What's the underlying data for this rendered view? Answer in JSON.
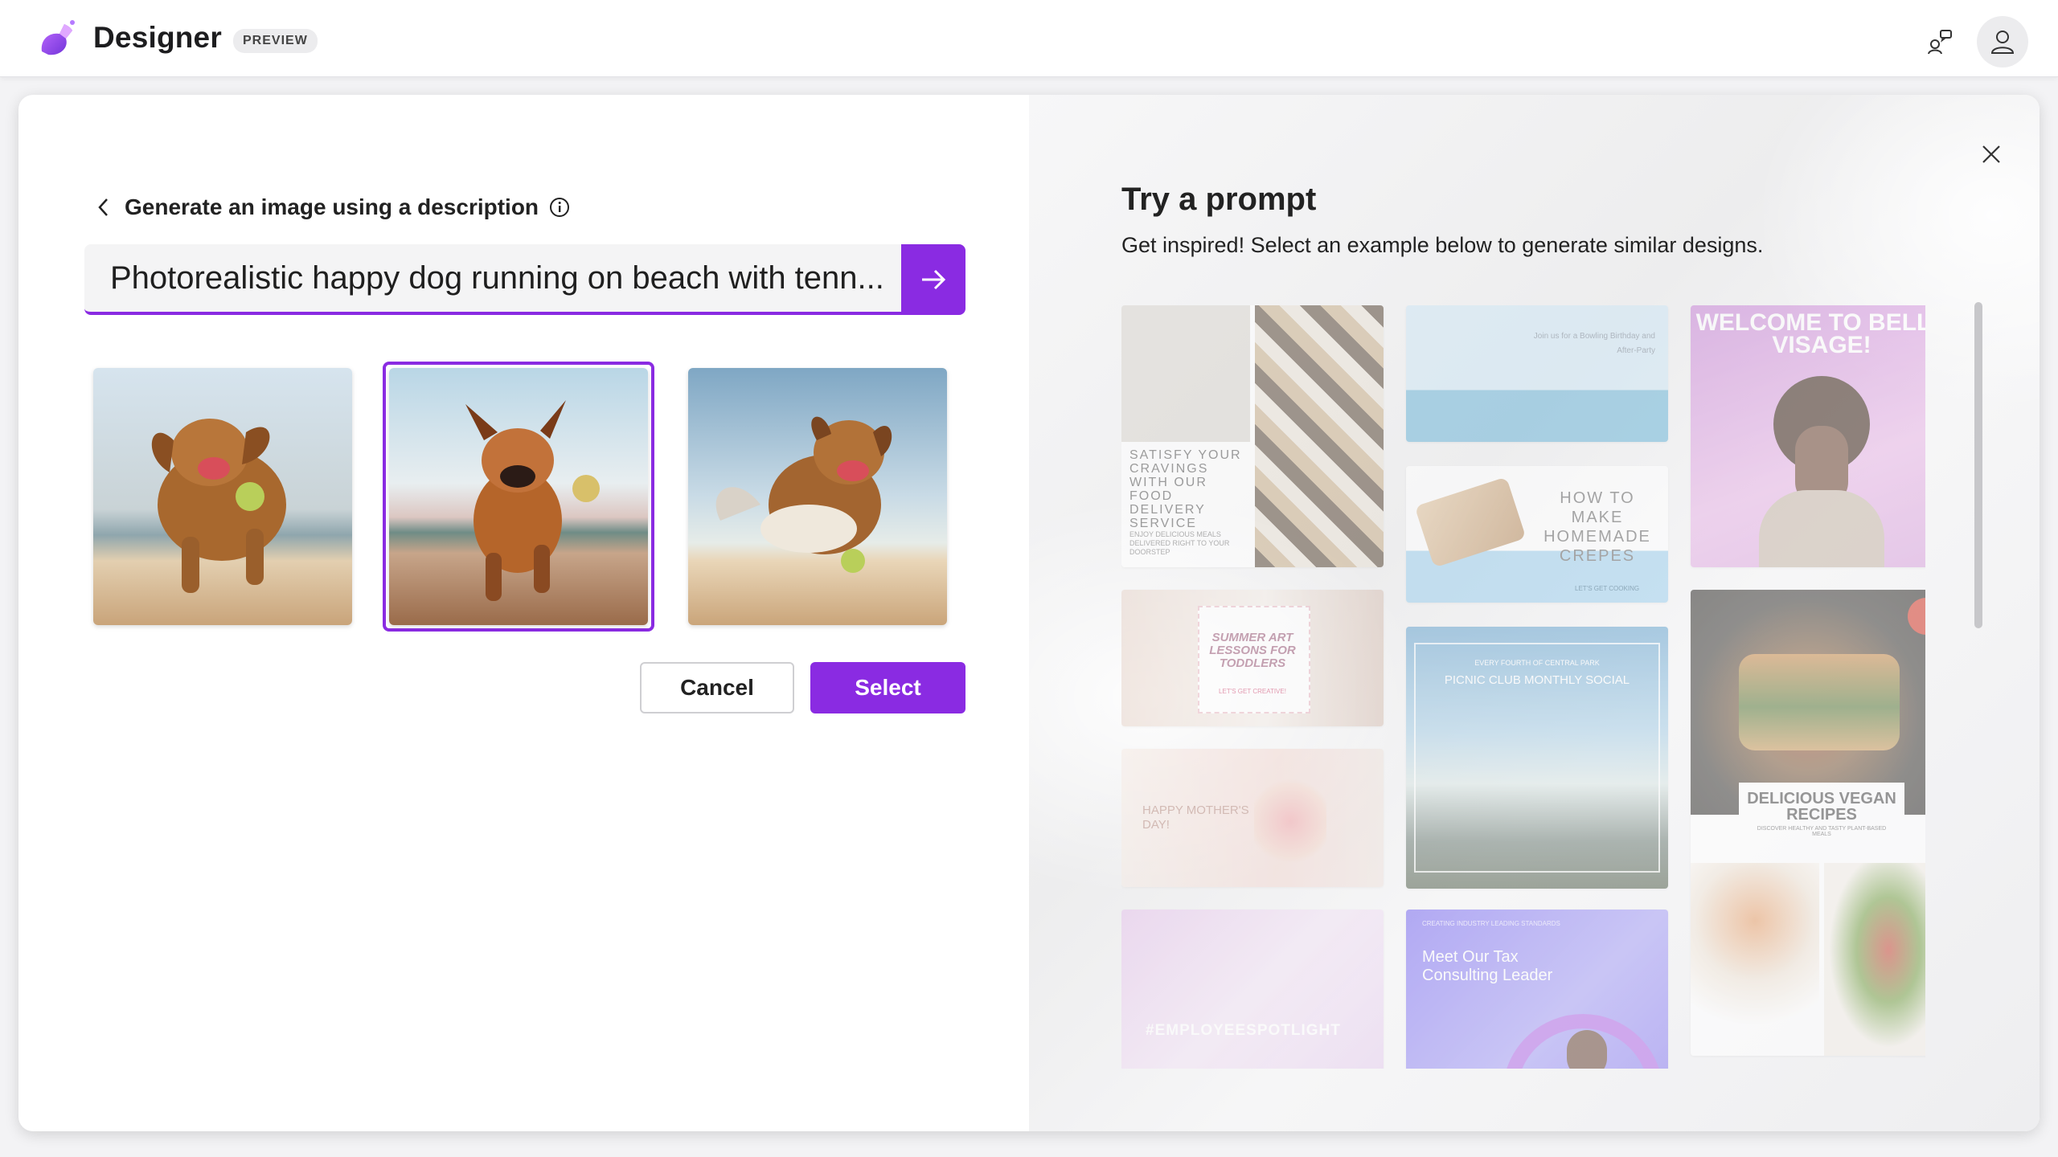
{
  "app": {
    "title": "Designer",
    "badge": "PREVIEW",
    "brand_color": "#8a2be2",
    "feedback_icon": "feedback-icon",
    "account_icon": "person-icon"
  },
  "generate": {
    "heading": "Generate an image using a description",
    "prompt_value": "Photorealistic happy dog running on beach with tenn...",
    "submit_icon": "arrow-right-icon",
    "selected_index": 1,
    "images": [
      {
        "alt": "dog-image-1"
      },
      {
        "alt": "dog-image-2"
      },
      {
        "alt": "dog-image-3"
      }
    ],
    "cancel_label": "Cancel",
    "select_label": "Select"
  },
  "inspire": {
    "title": "Try a prompt",
    "subtitle": "Get inspired! Select an example below to generate similar designs.",
    "cards": {
      "food_delivery": "SATISFY YOUR CRAVINGS WITH OUR FOOD DELIVERY SERVICE",
      "food_delivery_sub": "ENJOY DELICIOUS MEALS DELIVERED RIGHT TO YOUR DOORSTEP",
      "bday_title": "Join us for a Bowling Birthday and After-Party",
      "crepes": "HOW TO MAKE HOMEMADE CREPES",
      "crepes_sub": "LET'S GET COOKING",
      "belle": "WELCOME TO BELLE VISAGE!",
      "summer": "SUMMER ART LESSONS FOR TODDLERS",
      "summer_sub": "LET'S GET CREATIVE!",
      "picnic_small": "EVERY FOURTH OF CENTRAL PARK",
      "picnic": "PICNIC CLUB MONTHLY SOCIAL",
      "vegan": "DELICIOUS VEGAN RECIPES",
      "vegan_sub": "DISCOVER HEALTHY AND TASTY PLANT-BASED MEALS",
      "mother": "HAPPY MOTHER'S DAY!",
      "spotlight": "#EMPLOYEESPOTLIGHT",
      "tax_small": "CREATING INDUSTRY LEADING STANDARDS",
      "tax": "Meet Our Tax Consulting Leader"
    }
  }
}
